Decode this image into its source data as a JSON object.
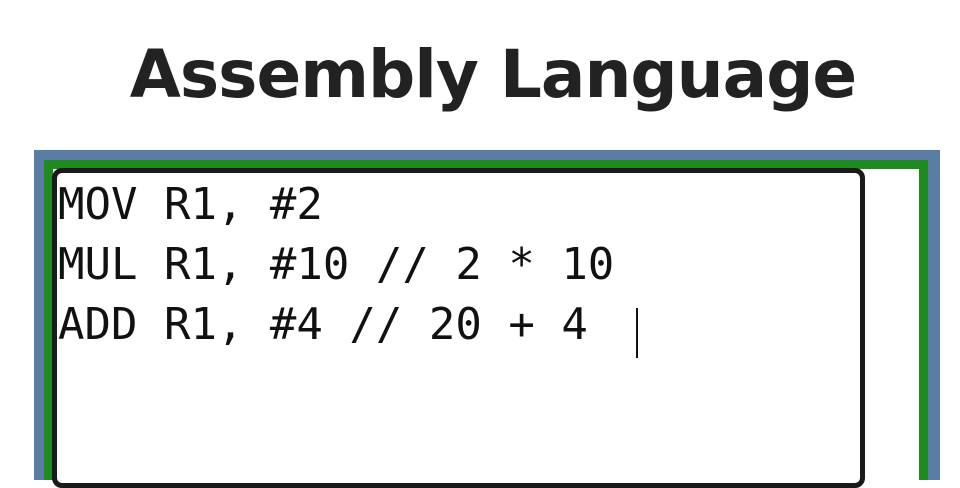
{
  "title": "Assembly Language",
  "editor": {
    "lines": [
      "MOV R1, #2",
      "MUL R1, #10 // 2 * 10",
      "ADD R1, #4 // 20 + 4"
    ]
  },
  "colors": {
    "outer_frame": "#5b7ca3",
    "inner_frame": "#1f8a1f",
    "editor_border": "#1a1a1a",
    "text": "#111111"
  }
}
